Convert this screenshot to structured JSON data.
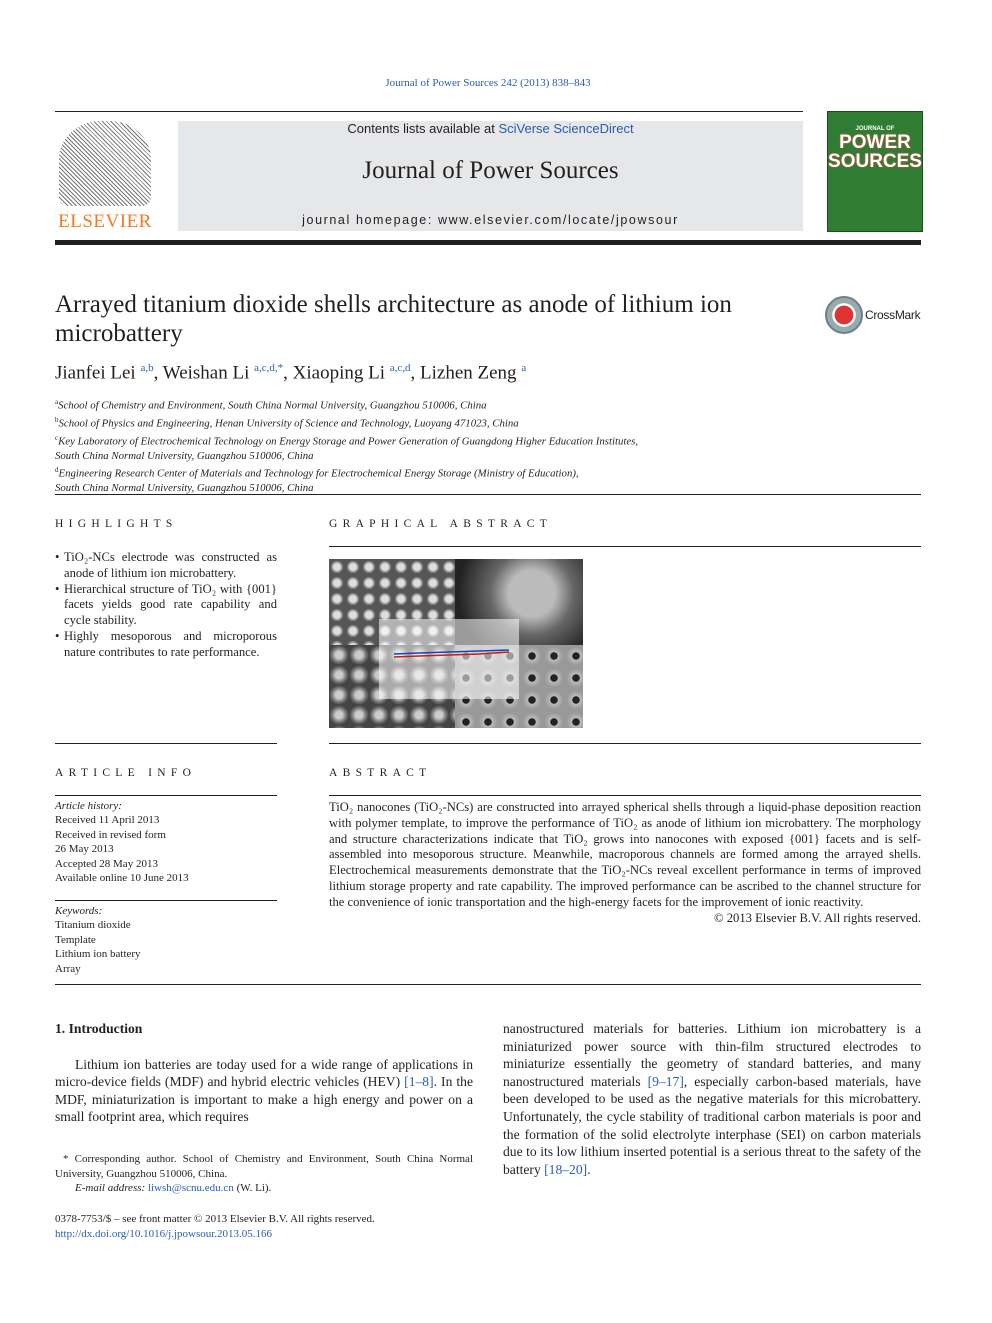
{
  "journal_ref": "Journal of Power Sources 242 (2013) 838–843",
  "header": {
    "contents_prefix": "Contents lists available at ",
    "contents_link": "SciVerse ScienceDirect",
    "journal_title": "Journal of Power Sources",
    "homepage_label": "journal homepage: ",
    "homepage_url": "www.elsevier.com/locate/jpowsour",
    "publisher": "ELSEVIER",
    "cover_top": "JOURNAL OF",
    "cover_title": "POWER SOURCES"
  },
  "title": "Arrayed titanium dioxide shells architecture as anode of lithium ion microbattery",
  "crossmark": "CrossMark",
  "authors": [
    {
      "name": "Jianfei Lei",
      "sup": "a,b"
    },
    {
      "name": "Weishan Li",
      "sup": "a,c,d,*"
    },
    {
      "name": "Xiaoping Li",
      "sup": "a,c,d"
    },
    {
      "name": "Lizhen Zeng",
      "sup": "a"
    }
  ],
  "affiliations": [
    {
      "sup": "a",
      "text": "School of Chemistry and Environment, South China Normal University, Guangzhou 510006, China"
    },
    {
      "sup": "b",
      "text": "School of Physics and Engineering, Henan University of Science and Technology, Luoyang 471023, China"
    },
    {
      "sup": "c",
      "text": "Key Laboratory of Electrochemical Technology on Energy Storage and Power Generation of Guangdong Higher Education Institutes,",
      "text2": "South China Normal University, Guangzhou 510006, China"
    },
    {
      "sup": "d",
      "text": "Engineering Research Center of Materials and Technology for Electrochemical Energy Storage (Ministry of Education),",
      "text2": "South China Normal University, Guangzhou 510006, China"
    }
  ],
  "highlights": {
    "heading": "HIGHLIGHTS",
    "items": [
      "TiO₂-NCs electrode was constructed as anode of lithium ion microbattery.",
      "Hierarchical structure of TiO₂ with {001} facets yields good rate capability and cycle stability.",
      "Highly mesoporous and microporous nature contributes to rate performance."
    ]
  },
  "graphical_abstract": {
    "heading": "GRAPHICAL ABSTRACT"
  },
  "article_info": {
    "heading": "ARTICLE INFO",
    "history_label": "Article history:",
    "history": [
      "Received 11 April 2013",
      "Received in revised form",
      "26 May 2013",
      "Accepted 28 May 2013",
      "Available online 10 June 2013"
    ],
    "keywords_label": "Keywords:",
    "keywords": [
      "Titanium dioxide",
      "Template",
      "Lithium ion battery",
      "Array"
    ]
  },
  "abstract": {
    "heading": "ABSTRACT",
    "text": "TiO₂ nanocones (TiO₂-NCs) are constructed into arrayed spherical shells through a liquid-phase deposition reaction with polymer template, to improve the performance of TiO₂ as anode of lithium ion microbattery. The morphology and structure characterizations indicate that TiO₂ grows into nanocones with exposed {001} facets and is self-assembled into mesoporous structure. Meanwhile, macroporous channels are formed among the arrayed shells. Electrochemical measurements demonstrate that the TiO₂-NCs reveal excellent performance in terms of improved lithium storage property and rate capability. The improved performance can be ascribed to the channel structure for the convenience of ionic transportation and the high-energy facets for the improvement of ionic reactivity.",
    "copyright": "© 2013 Elsevier B.V. All rights reserved."
  },
  "intro": {
    "heading": "1.  Introduction",
    "p1_a": "Lithium ion batteries are today used for a wide range of applications in micro-device fields (MDF) and hybrid electric vehicles (HEV) ",
    "ref1": "[1–8]",
    "p1_b": ". In the MDF, miniaturization is important to make a high energy and power on a small footprint area, which requires",
    "p2_a": "nanostructured materials for batteries. Lithium ion microbattery is a miniaturized power source with thin-film structured electrodes to miniaturize essentially the geometry of standard batteries, and many nanostructured materials ",
    "ref2": "[9–17]",
    "p2_b": ", especially carbon-based materials, have been developed to be used as the negative materials for this microbattery. Unfortunately, the cycle stability of traditional carbon materials is poor and the formation of the solid electrolyte interphase (SEI) on carbon materials due to its low lithium inserted potential is a serious threat to the safety of the battery ",
    "ref3": "[18–20]",
    "p2_c": "."
  },
  "footnote": {
    "text": "* Corresponding author. School of Chemistry and Environment, South China Normal University, Guangzhou 510006, China.",
    "email_label": "E-mail address: ",
    "email": "liwsh@scnu.edu.cn",
    "email_suffix": " (W. Li)."
  },
  "front_matter": "0378-7753/$ – see front matter © 2013 Elsevier B.V. All rights reserved.",
  "doi": "http://dx.doi.org/10.1016/j.jpowsour.2013.05.166",
  "colors": {
    "link": "#2a5db0",
    "elsevier_orange": "#f47920",
    "cover_green": "#2f7d32",
    "header_box": "#e6e7e8"
  }
}
